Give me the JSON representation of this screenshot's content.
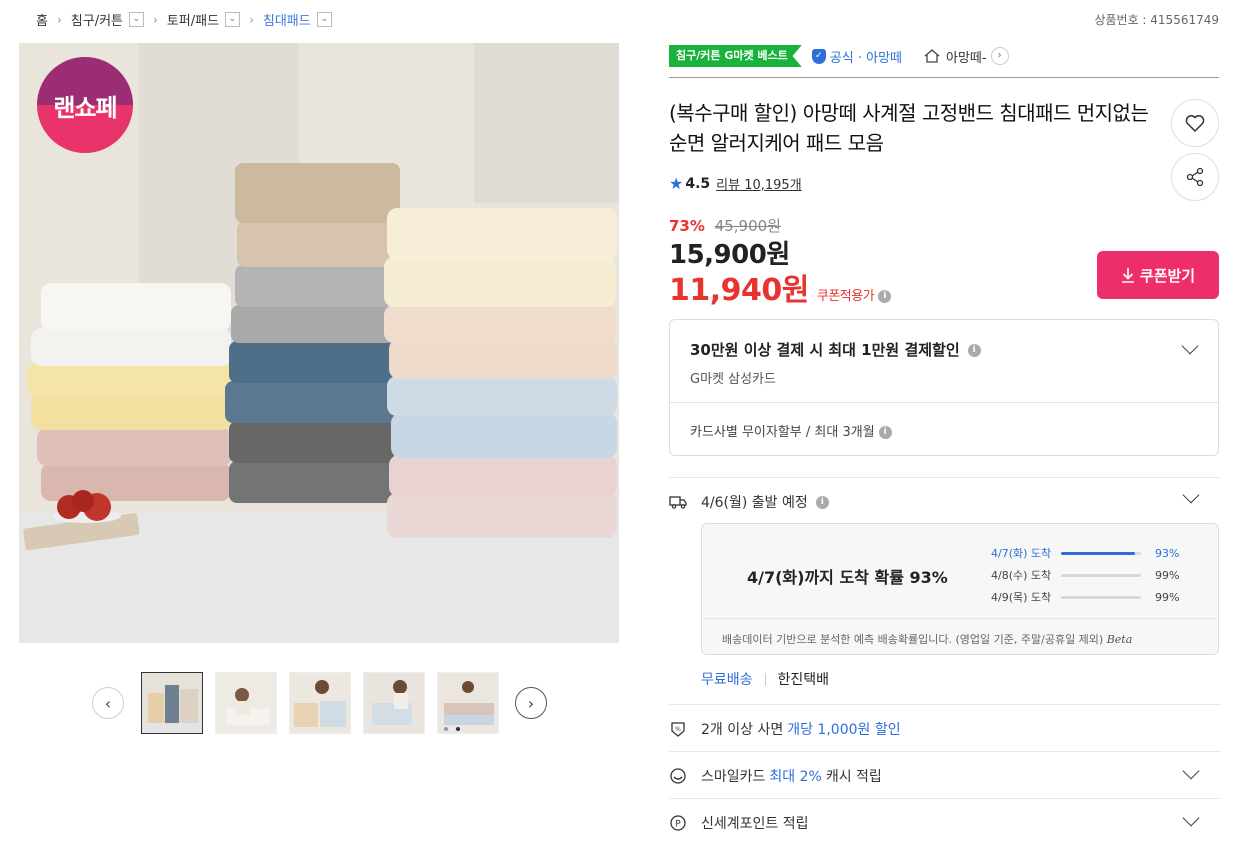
{
  "breadcrumb": {
    "items": [
      "홈",
      "침구/커튼",
      "토퍼/패드",
      "침대패드"
    ],
    "dropdown_icon": "chevron-down-icon"
  },
  "product_number": "상품번호 : 415561749",
  "main_image": {
    "logo_text": "랜쇼페",
    "colors": {
      "background": "#e8e3dc",
      "table": "#e6e6e6"
    }
  },
  "thumbnails": {
    "count": 5,
    "selected_index": 0
  },
  "badges": {
    "best": "침구/커튼 G마켓 베스트",
    "official": "공식 · 아망떼",
    "store": "아망떼-"
  },
  "title": "(복수구매 할인) 아망떼 사계절 고정밴드 침대패드 먼지없는 순면 알러지케어 패드 모음",
  "rating": {
    "score": "4.5",
    "review_link": "리뷰 10,195개"
  },
  "price": {
    "discount_pct": "73%",
    "original": "45,900원",
    "sale": "15,900원",
    "coupon_price": "11,940원",
    "coupon_note": "쿠폰적용가",
    "coupon_button": "쿠폰받기"
  },
  "card_promo": {
    "title": "30만원 이상 결제 시 최대 1만원 결제할인",
    "subtitle": "G마켓 삼성카드",
    "installment": "카드사별 무이자할부 / 최대 3개월"
  },
  "delivery": {
    "shipping_date": "4/6(월) 출발 예정",
    "headline": "4/7(화)까지 도착 확률 93%",
    "rows": [
      {
        "label": "4/7(화) 도착",
        "value": "93%",
        "fraction": 0.93
      },
      {
        "label": "4/8(수) 도착",
        "value": "99%",
        "fraction": 0.99
      },
      {
        "label": "4/9(목) 도착",
        "value": "99%",
        "fraction": 0.99
      }
    ],
    "footnote": "배송데이터 기반으로 분석한 예측 배송확률입니다. (영업일 기준, 주말/공휴일 제외)",
    "beta": "Beta",
    "free_shipping": "무료배송",
    "courier": "한진택배"
  },
  "benefits": [
    {
      "pre": "2개 이상 사면 ",
      "highlight": "개당 1,000원 할인",
      "post": ""
    },
    {
      "pre": "스마일카드 ",
      "highlight": "최대 2%",
      "post": " 캐시 적립"
    },
    {
      "pre": "신세계포인트 적립",
      "highlight": "",
      "post": ""
    }
  ],
  "colors": {
    "accent_blue": "#2c6fdb",
    "price_red": "#e8332e",
    "coupon_pink": "#ee2d6b",
    "best_green": "#19b33c"
  }
}
